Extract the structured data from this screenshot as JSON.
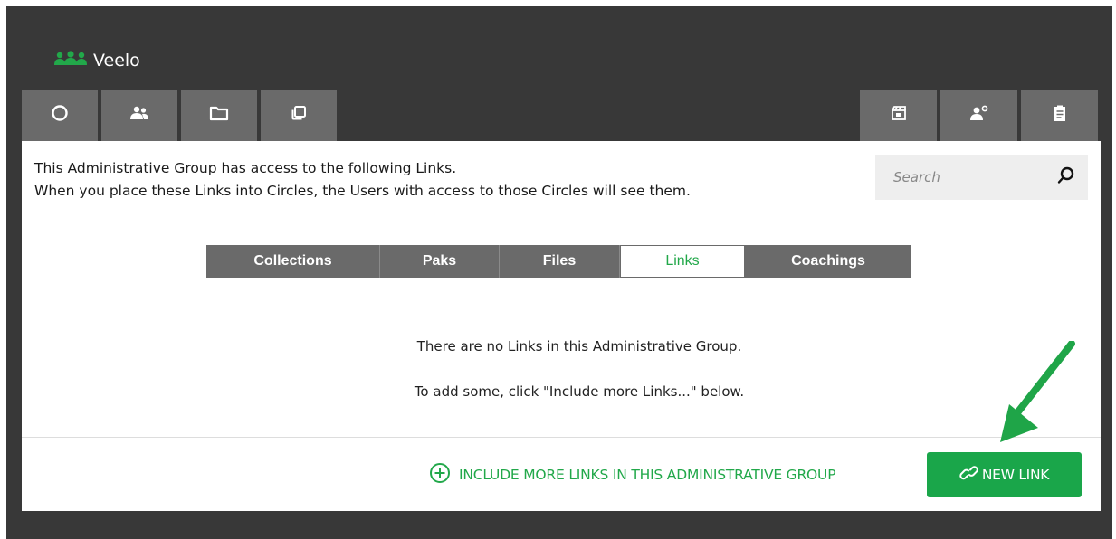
{
  "app": {
    "name": "Veelo"
  },
  "toolbar_left": [
    {
      "icon": "circle-icon"
    },
    {
      "icon": "users-icon"
    },
    {
      "icon": "folder-icon"
    },
    {
      "icon": "copy-icon"
    }
  ],
  "toolbar_right": [
    {
      "icon": "clapperboard-icon"
    },
    {
      "icon": "user-settings-icon"
    },
    {
      "icon": "clipboard-icon"
    }
  ],
  "intro": {
    "line1": "This Administrative Group has access to the following Links.",
    "line2": "When you place these Links into Circles, the Users with access to those Circles will see them."
  },
  "search": {
    "placeholder": "Search",
    "value": ""
  },
  "tabs": [
    {
      "label": "Collections",
      "active": false
    },
    {
      "label": "Paks",
      "active": false
    },
    {
      "label": "Files",
      "active": false
    },
    {
      "label": "Links",
      "active": true
    },
    {
      "label": "Coachings",
      "active": false
    }
  ],
  "empty_state": {
    "line1": "There are no Links in this Administrative Group.",
    "line2": "To add some, click \"Include more Links...\" below."
  },
  "footer": {
    "include_label": "INCLUDE MORE LINKS IN THIS ADMINISTRATIVE GROUP",
    "new_link_label": "NEW LINK"
  },
  "colors": {
    "accent": "#22a84a",
    "button": "#1aa64a",
    "chrome": "#383838",
    "tab": "#6a6a6a"
  }
}
